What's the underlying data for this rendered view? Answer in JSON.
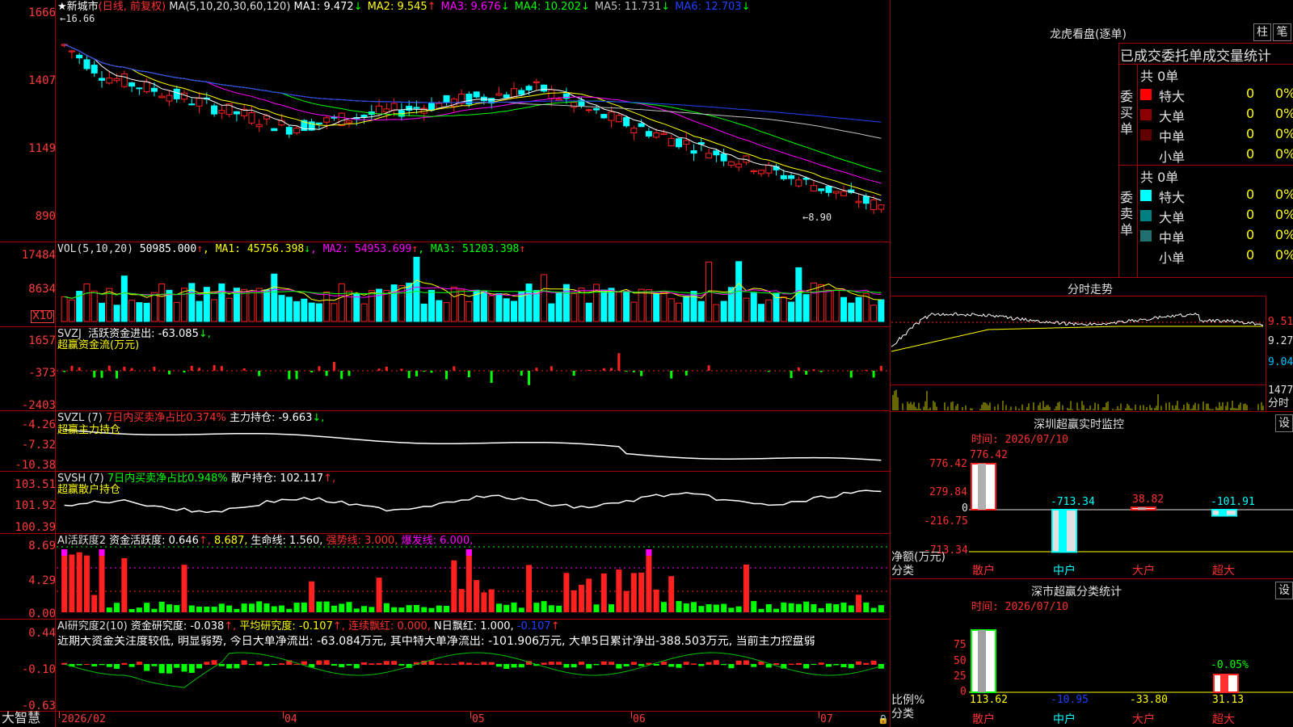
{
  "stock": {
    "title_symbol": "★",
    "name": "新城市",
    "period": "(日线, 前复权)",
    "ma_label": "MA(5,10,20,30,60,120)",
    "ma_values": [
      {
        "label": "MA1:",
        "value": "9.472",
        "arrow": "↓",
        "color": "#ffffff"
      },
      {
        "label": "MA2:",
        "value": "9.545",
        "arrow": "↑",
        "color": "#ffff00"
      },
      {
        "label": "MA3:",
        "value": "9.676",
        "arrow": "↓",
        "color": "#ff00ff"
      },
      {
        "label": "MA4:",
        "value": "10.202",
        "arrow": "↓",
        "color": "#00ff00"
      },
      {
        "label": "MA5:",
        "value": "11.731",
        "arrow": "↓",
        "color": "#c0c0c0"
      },
      {
        "label": "MA6:",
        "value": "12.703",
        "arrow": "↓",
        "color": "#2040ff"
      }
    ],
    "high_mark": "16.66",
    "low_mark": "8.90",
    "y_ticks": [
      "1666",
      "1407",
      "1149",
      "890"
    ]
  },
  "volume": {
    "label": "VOL(5,10,20)",
    "value": "50985.000",
    "value_arrow": "↑",
    "ma1": "MA1: 45756.398",
    "ma1_arrow": "↓",
    "ma2": "MA2: 54953.699",
    "ma2_arrow": "↑",
    "ma3": "MA3: 51203.398",
    "ma3_arrow": "↑",
    "y_ticks": [
      "17484",
      "8634"
    ],
    "unit": "X10"
  },
  "svzj": {
    "label": "SVZJ",
    "text": "活跃资金进出: -63.085",
    "arrow": "↓,",
    "subtitle": "超赢资金流(万元)",
    "y_ticks": [
      "1657",
      "-373",
      "-2403"
    ]
  },
  "svzl": {
    "label": "SVZL (7)",
    "ratio": "7日内买卖净占比0.374%",
    "hold": "主力持仓: -9.663",
    "arrow": "↓,",
    "subtitle": "超赢主力持仓",
    "y_ticks": [
      "-4.26",
      "-7.32",
      "-10.38"
    ]
  },
  "svsh": {
    "label": "SVSH (7)",
    "ratio": "7日内买卖净占比0.948%",
    "hold": "散户持仓: 102.117",
    "arrow": "↑,",
    "subtitle": "超赢散户持仓",
    "y_ticks": [
      "103.51",
      "101.92",
      "100.39"
    ]
  },
  "ai_active": {
    "label": "AI活跃度2",
    "text": "资金活跃度: 0.646",
    "val2": "8.687,",
    "life": "生命线: 1.560,",
    "strong": "强势线: 3.000,",
    "burst": "爆发线: 6.000,",
    "y_ticks": [
      "8.69",
      "4.29",
      "0.00"
    ]
  },
  "ai_research": {
    "label": "AI研究度2(10)",
    "text": "资金研究度: -0.038",
    "avg": "平均研究度: -0.107",
    "red": "连续飘红: 0.000,",
    "nred": "N日飘红: 1.000,",
    "last": "-0.107",
    "comment": "近期大资金关注度较低, 明显弱势, 今日大单净流出: -63.084万元, 其中特大单净流出: -101.906万元, 大单5日累计净出-388.503万元, 当前主力控盘弱",
    "y_ticks": [
      "0.44",
      "-0.10",
      "-0.63"
    ]
  },
  "xaxis": {
    "brand": "大智慧",
    "labels": [
      "2026/02",
      "04",
      "05",
      "06",
      "07"
    ]
  },
  "lhb": {
    "title": "龙虎看盘(逐单)",
    "btn1": "柱",
    "btn2": "笔",
    "subtitle": "已成交委托单成交量统计",
    "buy_label": "委买单",
    "sell_label": "委卖单",
    "buy_total": "共 0单",
    "sell_total": "共 0单",
    "rows": [
      {
        "name": "特大",
        "count": "0",
        "pct": "0%"
      },
      {
        "name": "大单",
        "count": "0",
        "pct": "0%"
      },
      {
        "name": "中单",
        "count": "0",
        "pct": "0%"
      },
      {
        "name": "小单",
        "count": "0",
        "pct": "0%"
      }
    ],
    "buy_colors": [
      "#ff0000",
      "#8b0000",
      "#600000",
      ""
    ],
    "sell_colors": [
      "#00ffff",
      "#008080",
      "#207070",
      ""
    ]
  },
  "intraday": {
    "title": "分时走势",
    "price_ticks": [
      "9.51",
      "9.27",
      "9.04"
    ],
    "vol_tick": "1477",
    "vol_label": "分时"
  },
  "sz_monitor": {
    "title": "深圳超赢实时监控",
    "btn": "设",
    "time": "时间: 2026/07/10",
    "y_ticks": [
      "776.42",
      "279.84",
      "0",
      "-216.75",
      "-713.34"
    ],
    "y_label": "净额(万元)",
    "x_label": "分类",
    "categories": [
      "散户",
      "中户",
      "大户",
      "超大"
    ],
    "values": [
      "776.42",
      "-713.34",
      "38.82",
      "-101.91"
    ]
  },
  "sz_class": {
    "title": "深市超赢分类统计",
    "btn": "设",
    "time": "时间: 2026/07/10",
    "y_ticks": [
      "75",
      "50",
      "25",
      "0"
    ],
    "y_label": "比例%",
    "x_label": "分类",
    "categories": [
      "散户",
      "中户",
      "大户",
      "超大"
    ],
    "values": [
      "113.62",
      "-10.95",
      "-33.80",
      "31.13"
    ],
    "annot": "-0.05%"
  }
}
